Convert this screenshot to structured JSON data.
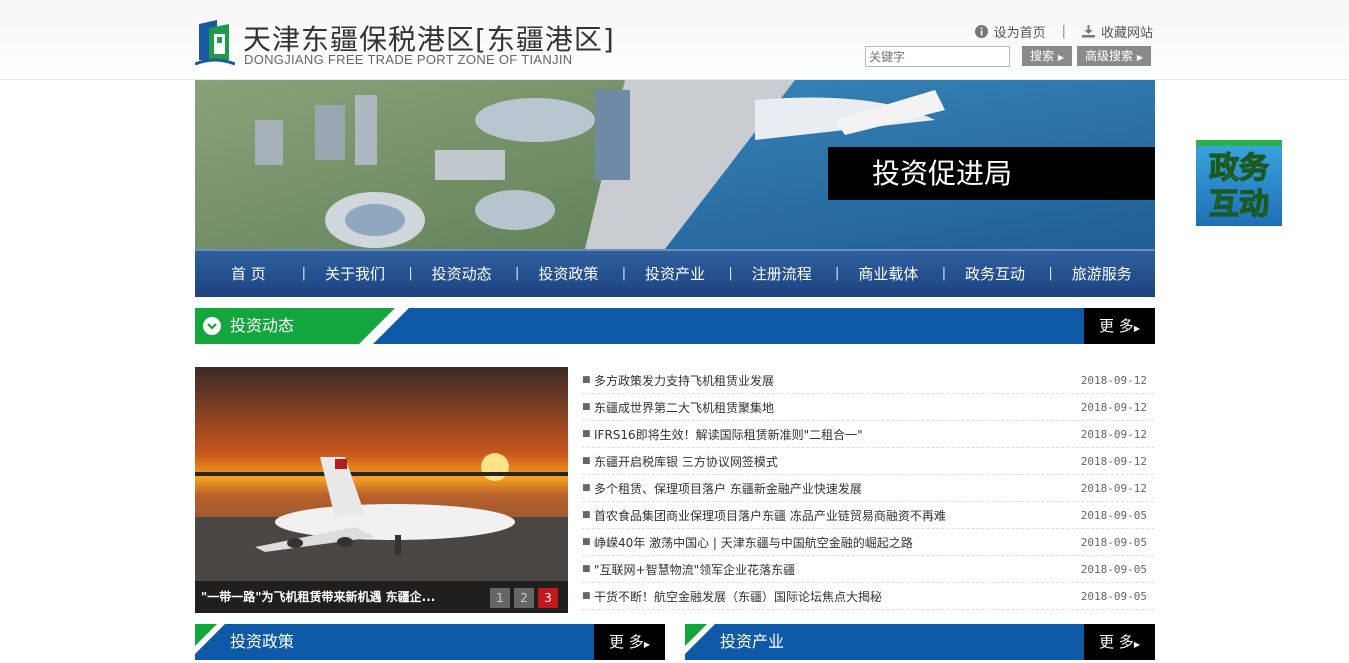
{
  "header": {
    "logo_cn": "天津东疆保税港区[东疆港区]",
    "logo_en": "DONGJIANG FREE TRADE PORT ZONE OF TIANJIN",
    "set_homepage": "设为首页",
    "separator": "|",
    "bookmark": "收藏网站",
    "search_placeholder": "关键字",
    "search_button": "搜索",
    "advanced_search_button": "高级搜索"
  },
  "banner": {
    "label": "投资促进局"
  },
  "float_ad": {
    "line1": "政务",
    "line2": "互动"
  },
  "nav": {
    "items": [
      {
        "label": "首 页"
      },
      {
        "label": "关于我们"
      },
      {
        "label": "投资动态"
      },
      {
        "label": "投资政策"
      },
      {
        "label": "投资产业"
      },
      {
        "label": "注册流程"
      },
      {
        "label": "商业载体"
      },
      {
        "label": "政务互动"
      },
      {
        "label": "旅游服务"
      }
    ]
  },
  "sections": {
    "dynamics": {
      "title": "投资动态",
      "more": "更 多"
    },
    "policy": {
      "title": "投资政策",
      "more": "更 多"
    },
    "industry": {
      "title": "投资产业",
      "more": "更 多"
    }
  },
  "carousel": {
    "caption": "\"一带一路\"为飞机租赁带来新机遇 东疆企...",
    "pages": [
      "1",
      "2",
      "3"
    ],
    "active_page": 3
  },
  "news": [
    {
      "title": "多方政策发力支持飞机租赁业发展",
      "date": "2018-09-12"
    },
    {
      "title": "东疆成世界第二大飞机租赁聚集地",
      "date": "2018-09-12"
    },
    {
      "title": "IFRS16即将生效！解读国际租赁新准则\"二租合一\"",
      "date": "2018-09-12"
    },
    {
      "title": "东疆开启税库银 三方协议网签模式",
      "date": "2018-09-12"
    },
    {
      "title": "多个租赁、保理项目落户 东疆新金融产业快速发展",
      "date": "2018-09-12"
    },
    {
      "title": "首农食品集团商业保理项目落户东疆 冻品产业链贸易商融资不再难",
      "date": "2018-09-05"
    },
    {
      "title": "峥嵘40年 激荡中国心 | 天津东疆与中国航空金融的崛起之路",
      "date": "2018-09-05"
    },
    {
      "title": "\"互联网+智慧物流\"领军企业花落东疆",
      "date": "2018-09-05"
    },
    {
      "title": "干货不断！航空金融发展（东疆）国际论坛焦点大揭秘",
      "date": "2018-09-05"
    }
  ],
  "colors": {
    "nav_blue": "#1c4380",
    "section_blue": "#0e5aa7",
    "section_green": "#13a63c",
    "active_dot": "#c4161c"
  }
}
